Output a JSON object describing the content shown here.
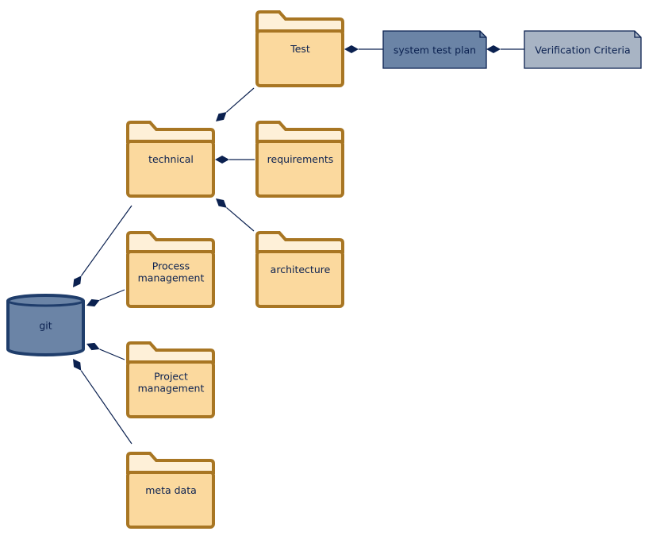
{
  "diagram": {
    "colors": {
      "folder_fill": "#fbd99e",
      "folder_tab_fill": "#fef0d8",
      "folder_stroke": "#a87623",
      "database_fill": "#6b84a6",
      "database_stroke": "#1f3d6b",
      "artifact_dark_fill": "#6b84a6",
      "artifact_light_fill": "#a8b4c4",
      "edge": "#0b2150"
    },
    "nodes": {
      "git": {
        "label": [
          "git"
        ],
        "shape": "database"
      },
      "test": {
        "label": [
          "Test"
        ],
        "shape": "folder"
      },
      "technical": {
        "label": [
          "technical"
        ],
        "shape": "folder"
      },
      "requirements": {
        "label": [
          "requirements"
        ],
        "shape": "folder"
      },
      "architecture": {
        "label": [
          "architecture"
        ],
        "shape": "folder"
      },
      "process": {
        "label": [
          "Process",
          "management"
        ],
        "shape": "folder"
      },
      "project": {
        "label": [
          "Project",
          "management"
        ],
        "shape": "folder"
      },
      "meta": {
        "label": [
          "meta data"
        ],
        "shape": "folder"
      },
      "stp": {
        "label": [
          "system test plan"
        ],
        "shape": "artifact"
      },
      "vc": {
        "label": [
          "Verification Criteria"
        ],
        "shape": "artifact"
      }
    },
    "edges": [
      {
        "whole": "git",
        "part": "technical",
        "type": "composition"
      },
      {
        "whole": "git",
        "part": "process",
        "type": "composition"
      },
      {
        "whole": "git",
        "part": "project",
        "type": "composition"
      },
      {
        "whole": "git",
        "part": "meta",
        "type": "composition"
      },
      {
        "whole": "technical",
        "part": "test",
        "type": "composition"
      },
      {
        "whole": "technical",
        "part": "requirements",
        "type": "composition"
      },
      {
        "whole": "technical",
        "part": "architecture",
        "type": "composition"
      },
      {
        "whole": "test",
        "part": "stp",
        "type": "composition"
      },
      {
        "whole": "stp",
        "part": "vc",
        "type": "composition"
      }
    ]
  }
}
